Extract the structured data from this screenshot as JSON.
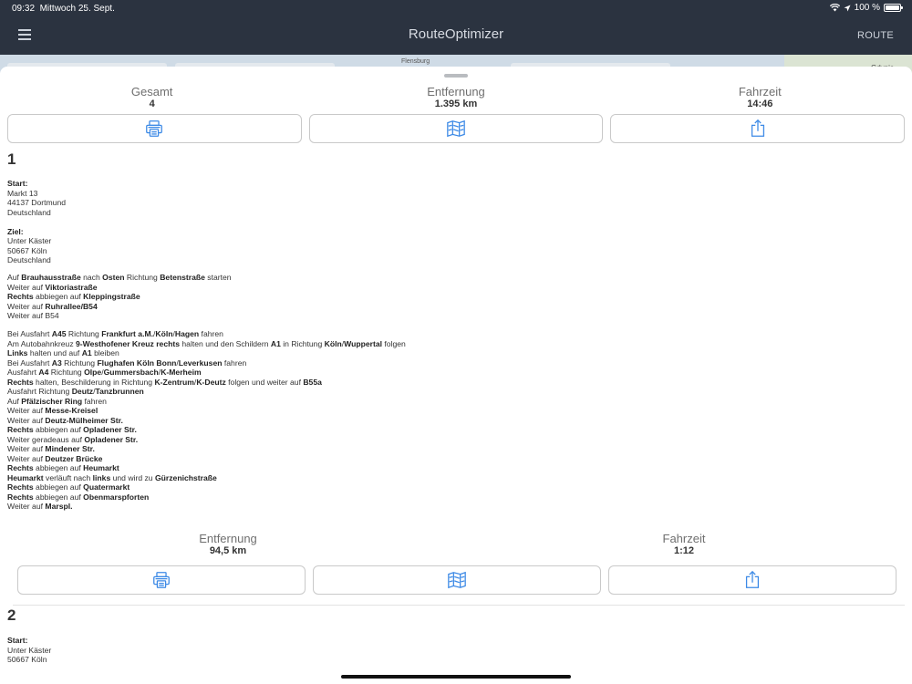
{
  "status_bar": {
    "time": "09:32",
    "date": "Mittwoch 25. Sept.",
    "battery": "100 %"
  },
  "nav": {
    "title": "RouteOptimizer",
    "route_label": "ROUTE"
  },
  "map": {
    "label_left": "Flensburg",
    "label_right": "Gdynia"
  },
  "summary": {
    "total_label": "Gesamt",
    "total_value": "4",
    "distance_label": "Entfernung",
    "distance_value": "1.395 km",
    "duration_label": "Fahrzeit",
    "duration_value": "14:46"
  },
  "icons": {
    "print": "printer-icon",
    "map": "map-icon",
    "share": "share-icon",
    "accent": "#3d8ae6"
  },
  "legs": [
    {
      "number": "1",
      "start_label": "Start:",
      "start_lines": [
        "Markt 13",
        "44137 Dortmund",
        "Deutschland"
      ],
      "end_label": "Ziel:",
      "end_lines": [
        "Unter Käster",
        "50667 Köln",
        "Deutschland"
      ],
      "directions_a": [
        "Auf <b>Brauhausstraße</b> nach <b>Osten</b> Richtung <b>Betenstraße</b> starten",
        "Weiter auf <b>Viktoriastraße</b>",
        "<b>Rechts</b> abbiegen auf <b>Kleppingstraße</b>",
        "Weiter auf <b>Ruhrallee/B54</b>",
        "Weiter auf B54"
      ],
      "directions_b": [
        "Bei Ausfahrt <b>A45</b> Richtung <b>Frankfurt a.M.</b>/<b>Köln</b>/<b>Hagen</b> fahren",
        "Am Autobahnkreuz <b>9-Westhofener Kreuz rechts</b> halten und den Schildern <b>A1</b> in Richtung <b>Köln</b>/<b>Wuppertal</b> folgen",
        "<b>Links</b> halten und auf <b>A1</b> bleiben",
        "Bei Ausfahrt <b>A3</b> Richtung <b>Flughafen Köln Bonn</b>/<b>Leverkusen</b> fahren",
        "Ausfahrt <b>A4</b> Richtung <b>Olpe</b>/<b>Gummersbach</b>/<b>K-Merheim</b>",
        "<b>Rechts</b> halten, Beschilderung in Richtung <b>K-Zentrum</b>/<b>K-Deutz</b> folgen und weiter auf <b>B55a</b>",
        "Ausfahrt Richtung <b>Deutz</b>/<b>Tanzbrunnen</b>",
        "Auf <b>Pfälzischer Ring</b> fahren",
        "Weiter auf <b>Messe-Kreisel</b>",
        "Weiter auf <b>Deutz-Mülheimer Str.</b>",
        "<b>Rechts</b> abbiegen auf <b>Opladener Str.</b>",
        "Weiter geradeaus auf <b>Opladener Str.</b>",
        "Weiter auf <b>Mindener Str.</b>",
        "Weiter auf <b>Deutzer Brücke</b>",
        "<b>Rechts</b> abbiegen auf <b>Heumarkt</b>",
        "<b>Heumarkt</b> verläuft nach <b>links</b> und wird zu <b>Gürzenichstraße</b>",
        "<b>Rechts</b> abbiegen auf <b>Quatermarkt</b>",
        "<b>Rechts</b> abbiegen auf <b>Obenmarspforten</b>",
        "Weiter auf <b>Marspl.</b>"
      ],
      "distance_label": "Entfernung",
      "distance_value": "94,5 km",
      "duration_label": "Fahrzeit",
      "duration_value": "1:12"
    },
    {
      "number": "2",
      "start_label": "Start:",
      "start_lines": [
        "Unter Käster",
        "50667 Köln"
      ]
    }
  ]
}
